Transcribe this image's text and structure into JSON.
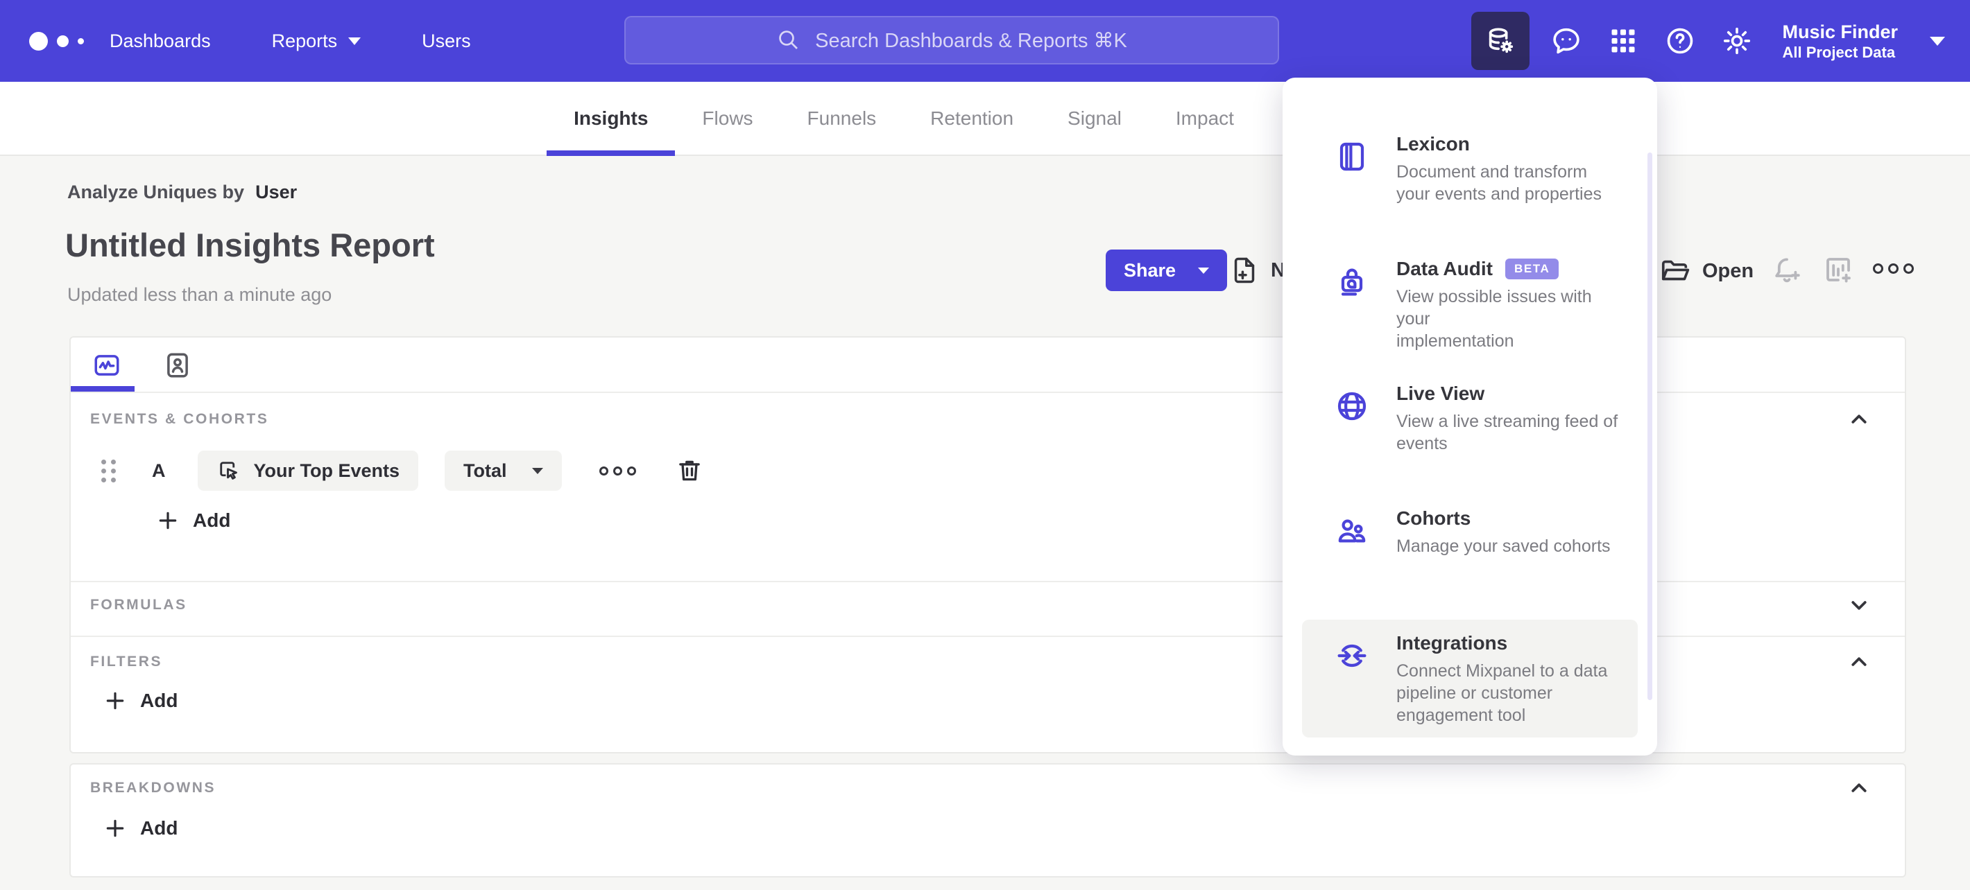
{
  "navbar": {
    "links": [
      "Dashboards",
      "Reports",
      "Users"
    ],
    "search_placeholder": "Search Dashboards & Reports ⌘K",
    "project_name": "Music Finder",
    "project_scope": "All Project Data"
  },
  "tabs": {
    "items": [
      "Insights",
      "Flows",
      "Funnels",
      "Retention",
      "Signal",
      "Impact"
    ],
    "active": "Insights"
  },
  "header": {
    "analyze_label": "Analyze Uniques by",
    "analyze_value": "User",
    "title": "Untitled Insights Report",
    "updated": "Updated less than a minute ago",
    "share": "Share",
    "new": "New",
    "open": "Open"
  },
  "builder": {
    "events_label": "EVENTS & COHORTS",
    "event_letter": "A",
    "event_name": "Your Top Events",
    "metric": "Total",
    "add": "Add",
    "formulas_label": "FORMULAS",
    "filters_label": "FILTERS",
    "breakdowns_label": "BREAKDOWNS"
  },
  "data_menu": {
    "items": [
      {
        "title": "Lexicon",
        "lines": [
          "Document and transform",
          "your events and properties"
        ]
      },
      {
        "title": "Data Audit",
        "badge": "BETA",
        "lines": [
          "View possible issues with your",
          "implementation"
        ]
      },
      {
        "title": "Live View",
        "lines": [
          "View a live streaming feed of",
          "events"
        ]
      },
      {
        "title": "Cohorts",
        "lines": [
          "Manage your saved cohorts"
        ]
      },
      {
        "title": "Integrations",
        "lines": [
          "Connect Mixpanel to a data",
          "pipeline or customer",
          "engagement tool"
        ]
      }
    ]
  },
  "colors": {
    "accent": "#4B43D9",
    "nav_active_bg": "#2F2A63",
    "beta_badge": "#938BE9",
    "page_bg": "#F6F6F4"
  }
}
